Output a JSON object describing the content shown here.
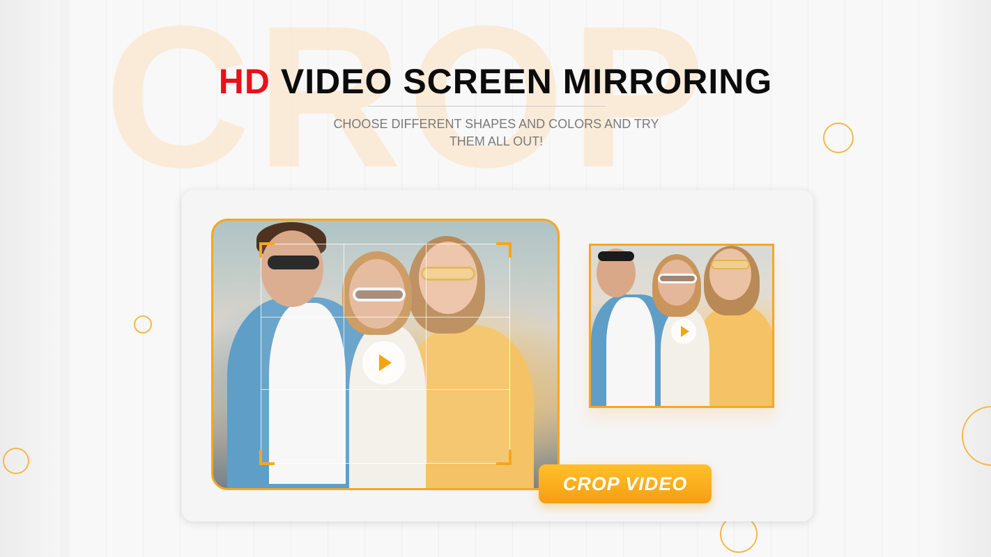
{
  "background": {
    "watermark_text": "CROP",
    "accent_color": "#f7a61c",
    "highlight_color": "#e8111a"
  },
  "header": {
    "title_highlight": "HD",
    "title_rest": " VIDEO SCREEN MIRRORING",
    "subtitle": "CHOOSE DIFFERENT SHAPES AND COLORS AND TRY THEM ALL OUT!"
  },
  "editor": {
    "main_play_icon": "play-icon",
    "thumb_play_icon": "play-icon",
    "action_button_label": "CROP VIDEO"
  }
}
